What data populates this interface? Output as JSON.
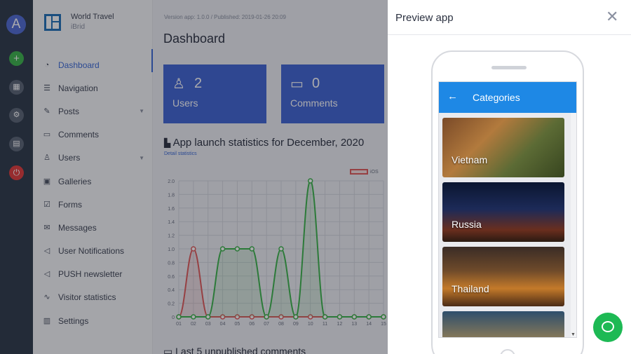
{
  "rail": {
    "avatar_letter": "A",
    "icons": [
      "add-icon",
      "grid-icon",
      "gear-icon",
      "card-icon",
      "power-icon"
    ]
  },
  "sidebar": {
    "app_name": "World Travel",
    "app_sub": "iBrid",
    "items": [
      {
        "label": "Dashboard",
        "icon": "dashboard-icon",
        "active": true
      },
      {
        "label": "Navigation",
        "icon": "list-icon"
      },
      {
        "label": "Posts",
        "icon": "pin-icon",
        "has_submenu": true
      },
      {
        "label": "Comments",
        "icon": "comment-icon"
      },
      {
        "label": "Users",
        "icon": "user-icon",
        "has_submenu": true
      },
      {
        "label": "Galleries",
        "icon": "image-icon"
      },
      {
        "label": "Forms",
        "icon": "checkbox-icon"
      },
      {
        "label": "Messages",
        "icon": "message-icon"
      },
      {
        "label": "User Notifications",
        "icon": "megaphone-icon"
      },
      {
        "label": "PUSH newsletter",
        "icon": "megaphone-icon"
      },
      {
        "label": "Visitor statistics",
        "icon": "pulse-icon"
      },
      {
        "label": "Settings",
        "icon": "settings-icon"
      }
    ]
  },
  "main": {
    "version_text": "Version app: 1.0.0 / Published: 2019-01-26 20:09",
    "title": "Dashboard",
    "cards": [
      {
        "icon": "user-icon",
        "value": "2",
        "label": "Users"
      },
      {
        "icon": "comment-icon",
        "value": "0",
        "label": "Comments"
      }
    ],
    "stats_title": "App launch statistics for December, 2020",
    "stats_sub": "Detail statistics",
    "legend_label": "iOS",
    "lower_title": "Last 5 unpublished comments"
  },
  "chart_data": {
    "type": "line",
    "x": [
      "01",
      "02",
      "03",
      "04",
      "05",
      "06",
      "07",
      "08",
      "09",
      "10",
      "11",
      "12",
      "13",
      "14",
      "15"
    ],
    "ylim": [
      0,
      2.0
    ],
    "yticks": [
      "0",
      "0.2",
      "0.4",
      "0.6",
      "0.8",
      "1.0",
      "1.2",
      "1.4",
      "1.6",
      "1.8",
      "2.0"
    ],
    "grid": true,
    "series": [
      {
        "name": "iOS",
        "color": "#e05a5a",
        "values": [
          0,
          1,
          0,
          0,
          0,
          0,
          0,
          0,
          0,
          0,
          0,
          0,
          0,
          0,
          0
        ]
      },
      {
        "color": "#3bb54a",
        "values": [
          0,
          0,
          0,
          1,
          1,
          1,
          0,
          1,
          0,
          2,
          0,
          0,
          0,
          0,
          0
        ]
      }
    ]
  },
  "preview": {
    "title": "Preview app",
    "close_label": "✕",
    "app_title": "Categories",
    "back_label": "←",
    "categories": [
      "Vietnam",
      "Russia",
      "Thailand"
    ]
  },
  "colors": {
    "accent": "#3a69d6",
    "card": "#3f64d3",
    "appbar": "#1e88e5",
    "rail": "#2d3949",
    "chat": "#1db954"
  }
}
